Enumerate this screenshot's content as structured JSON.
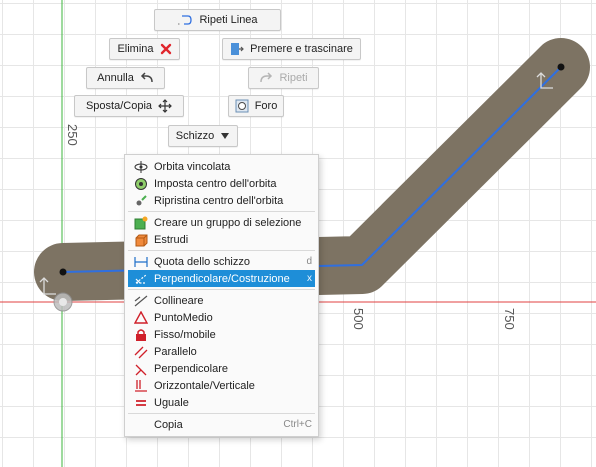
{
  "canvas": {
    "axis_labels": {
      "y_250": "250",
      "x_500": "500",
      "x_750": "750"
    },
    "colors": {
      "slot_fill": "#7d7363",
      "sketch_line": "#2f6fe0",
      "x_axis": "#e04040",
      "y_axis": "#3db53d"
    }
  },
  "marking_menu": {
    "repeat_line": "Ripeti Linea",
    "delete": "Elimina",
    "press_pull": "Premere e trascinare",
    "undo": "Annulla",
    "redo": "Ripeti",
    "move_copy": "Sposta/Copia",
    "hole": "Foro",
    "sketch": "Schizzo"
  },
  "context_menu": {
    "items": [
      {
        "icon": "orbit-constrained-icon",
        "label": "Orbita vincolata",
        "shortcut": ""
      },
      {
        "icon": "orbit-center-icon",
        "label": "Imposta centro dell'orbita",
        "shortcut": ""
      },
      {
        "icon": "reset-orbit-icon",
        "label": "Ripristina centro dell'orbita",
        "shortcut": ""
      },
      {
        "icon": "selection-group-icon",
        "label": "Creare un gruppo di selezione",
        "shortcut": ""
      },
      {
        "icon": "extrude-icon",
        "label": "Estrudi",
        "shortcut": ""
      },
      {
        "icon": "sketch-dimension-icon",
        "label": "Quota dello schizzo",
        "shortcut": "d"
      },
      {
        "icon": "normal-construction-icon",
        "label": "Perpendicolare/Costruzione",
        "shortcut": "x"
      },
      {
        "icon": "collinear-icon",
        "label": "Collineare",
        "shortcut": ""
      },
      {
        "icon": "midpoint-icon",
        "label": "PuntoMedio",
        "shortcut": ""
      },
      {
        "icon": "fix-unfix-icon",
        "label": "Fisso/mobile",
        "shortcut": ""
      },
      {
        "icon": "parallel-icon",
        "label": "Parallelo",
        "shortcut": ""
      },
      {
        "icon": "perpendicular-icon",
        "label": "Perpendicolare",
        "shortcut": ""
      },
      {
        "icon": "horizontal-vertical-icon",
        "label": "Orizzontale/Verticale",
        "shortcut": ""
      },
      {
        "icon": "equal-icon",
        "label": "Uguale",
        "shortcut": ""
      },
      {
        "icon": "",
        "label": "Copia",
        "shortcut": "Ctrl+C"
      }
    ],
    "highlighted_index": 6
  }
}
